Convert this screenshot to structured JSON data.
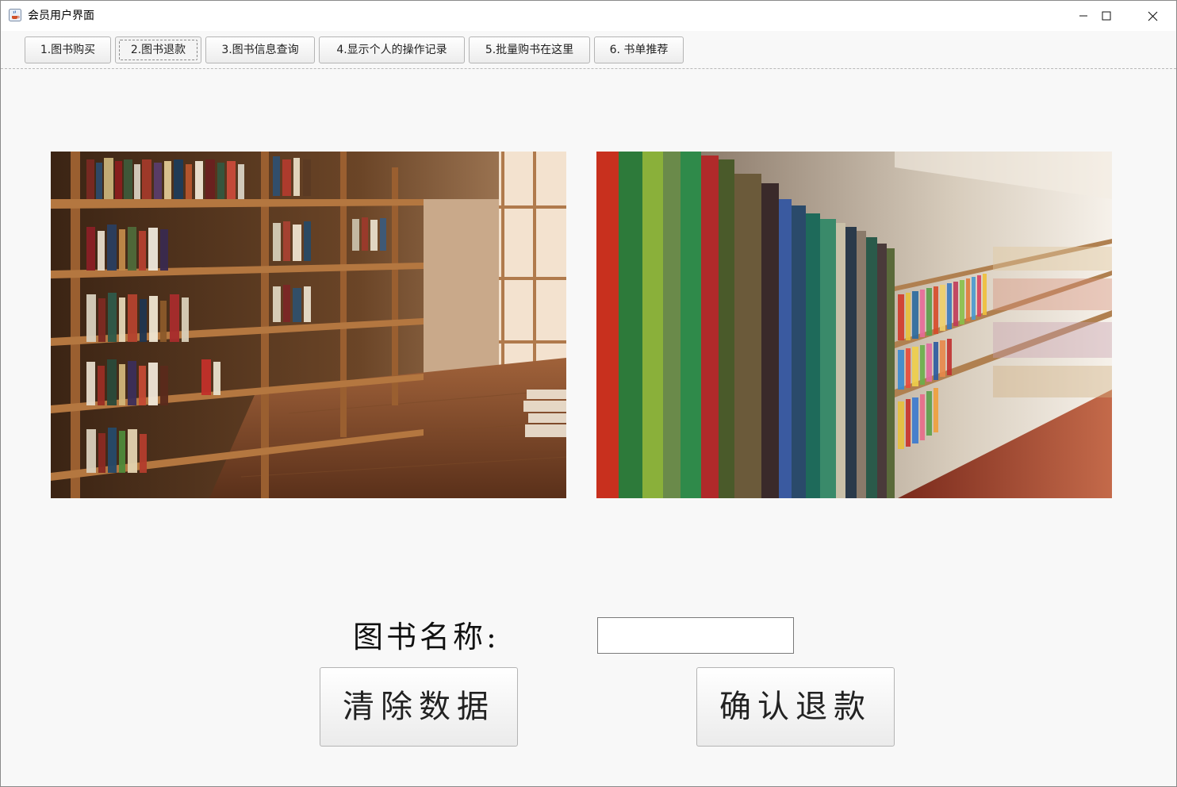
{
  "window": {
    "title": "会员用户界面",
    "app_icon": "java-coffee-icon",
    "controls": [
      "minimize-icon",
      "maximize-icon",
      "close-icon"
    ]
  },
  "tabs": [
    {
      "label": "1.图书购买",
      "active": false
    },
    {
      "label": "2.图书退款",
      "active": true
    },
    {
      "label": "3.图书信息查询",
      "active": false
    },
    {
      "label": "4.显示个人的操作记录",
      "active": false
    },
    {
      "label": "5.批量购书在这里",
      "active": false
    },
    {
      "label": "6. 书单推荐",
      "active": false
    }
  ],
  "form": {
    "book_name_label": "图书名称:",
    "book_name_value": "",
    "clear_button": "清除数据",
    "confirm_button": "确认退款"
  },
  "colors": {
    "background": "#f8f8f8",
    "titlebar": "#ffffff",
    "border": "#b4b4b4"
  }
}
